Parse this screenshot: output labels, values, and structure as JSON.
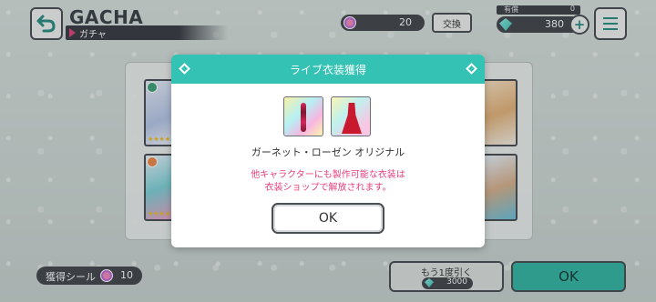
{
  "header": {
    "title": "GACHA",
    "subtitle": "ガチャ",
    "seal_count": "20",
    "exchange_label": "交換",
    "paid_label": "有償",
    "paid_value": "0",
    "gem_count": "380"
  },
  "dialog": {
    "title": "ライブ衣装獲得",
    "costume_name": "ガーネット・ローゼン オリジナル",
    "notice_line1": "他キャラクターにも製作可能な衣装は",
    "notice_line2": "衣装ショップで解放されます。",
    "ok_label": "OK"
  },
  "bottom": {
    "get_seal_label": "獲得シール",
    "get_seal_value": "10",
    "again_label": "もう1度引く",
    "again_cost": "3000",
    "ok_label": "OK"
  },
  "colors": {
    "accent_teal": "#33c2b3",
    "notice_pink": "#e8407e",
    "dark_pill": "#45494f"
  }
}
